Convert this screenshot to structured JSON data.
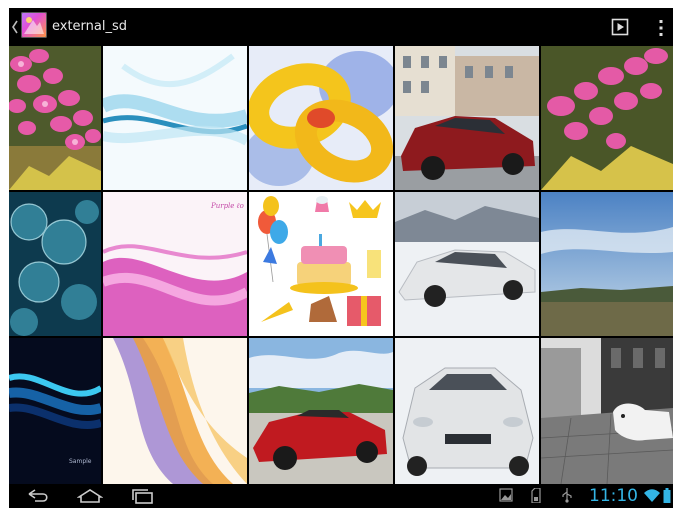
{
  "action_bar": {
    "title": "external_sd",
    "icons": [
      "back-caret-icon",
      "gallery-app-icon",
      "slideshow-icon",
      "overflow-menu-icon"
    ]
  },
  "grid": {
    "columns": 5,
    "rows": 3,
    "items": [
      {
        "subject": "pink orchids"
      },
      {
        "subject": "blue abstract waves"
      },
      {
        "subject": "yellow 3d rings"
      },
      {
        "subject": "red sports car in town"
      },
      {
        "subject": "pink orchids"
      },
      {
        "subject": "blue bokeh circles"
      },
      {
        "subject": "pink abstract swirl",
        "caption": "Purple ℓo"
      },
      {
        "subject": "birthday party items"
      },
      {
        "subject": "white sports car in snow"
      },
      {
        "subject": "landscape sky"
      },
      {
        "subject": "dark blue waves",
        "caption": "Sample"
      },
      {
        "subject": "orange purple swirl"
      },
      {
        "subject": "red convertible"
      },
      {
        "subject": "white sports car front"
      },
      {
        "subject": "street with dog"
      }
    ]
  },
  "nav_bar": {
    "buttons": [
      "back-icon",
      "home-icon",
      "recent-apps-icon"
    ],
    "status_icons": [
      "gallery-notification-icon",
      "sd-card-icon",
      "usb-icon",
      "wifi-icon",
      "battery-icon"
    ],
    "time": "11:10"
  },
  "colors": {
    "accent": "#33b5e5",
    "bar_background": "#000000"
  }
}
